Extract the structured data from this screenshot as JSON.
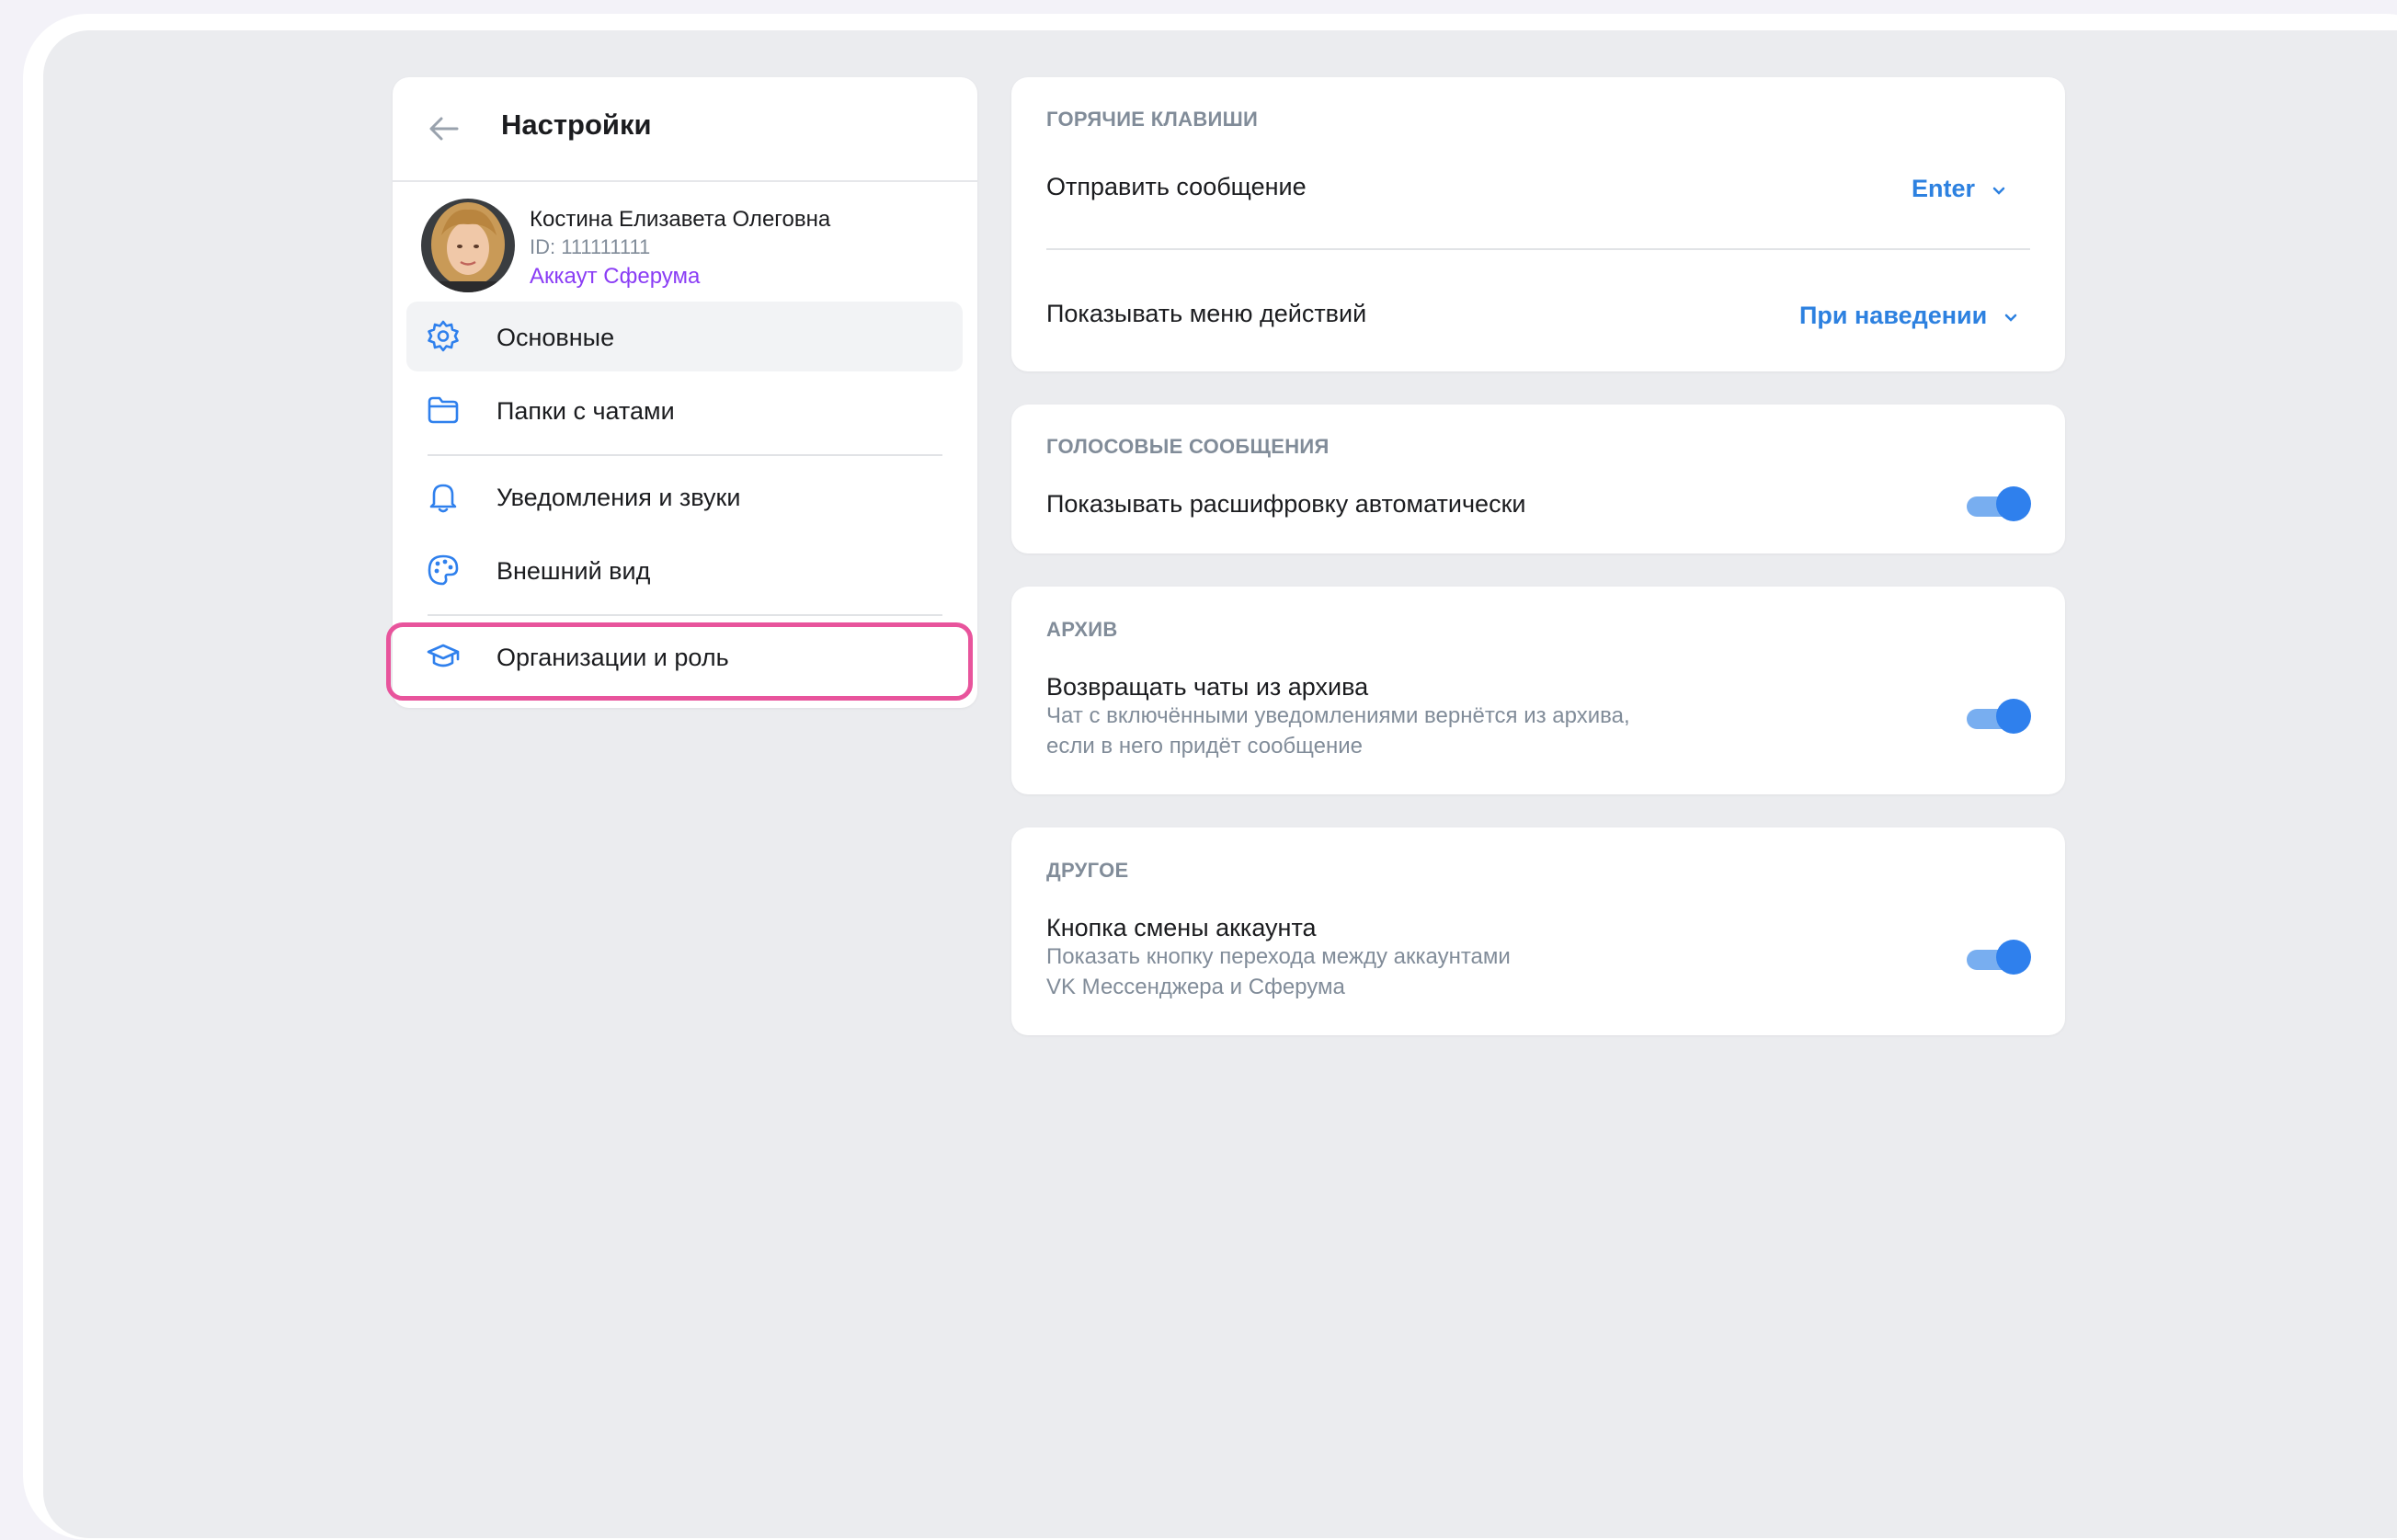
{
  "sidebar": {
    "title": "Настройки",
    "profile": {
      "name": "Костина Елизавета Олеговна",
      "id": "ID: 111111111",
      "account": "Аккаут Сферума"
    },
    "items": [
      {
        "label": "Основные",
        "icon": "gear-icon",
        "active": true
      },
      {
        "label": "Папки с чатами",
        "icon": "folder-icon"
      },
      {
        "label": "Уведомления и звуки",
        "icon": "bell-icon"
      },
      {
        "label": "Внешний вид",
        "icon": "palette-icon"
      },
      {
        "label": "Организации и роль",
        "icon": "graduation-cap-icon",
        "highlighted": true
      }
    ]
  },
  "hotkeys": {
    "title": "ГОРЯЧИЕ КЛАВИШИ",
    "send_label": "Отправить сообщение",
    "send_value": "Enter",
    "menu_label": "Показывать меню действий",
    "menu_value": "При наведении"
  },
  "voice": {
    "title": "ГОЛОСОВЫЕ СООБЩЕНИЯ",
    "transcribe_label": "Показывать расшифровку автоматически",
    "transcribe_on": true
  },
  "archive": {
    "title": "АРХИВ",
    "return_label": "Возвращать чаты из архива",
    "return_sub_1": "Чат с включёнными уведомлениями вернётся из архива,",
    "return_sub_2": "если в него придёт сообщение",
    "return_on": true
  },
  "other": {
    "title": "ДРУГОЕ",
    "switch_label": "Кнопка смены аккаунта",
    "switch_sub_1": "Показать кнопку перехода между аккаунтами",
    "switch_sub_2": "VK Мессенджера и Сферума",
    "switch_on": true
  },
  "colors": {
    "accent": "#2f80ed",
    "brand_purple": "#8a3df5",
    "highlight": "#e8549c"
  }
}
